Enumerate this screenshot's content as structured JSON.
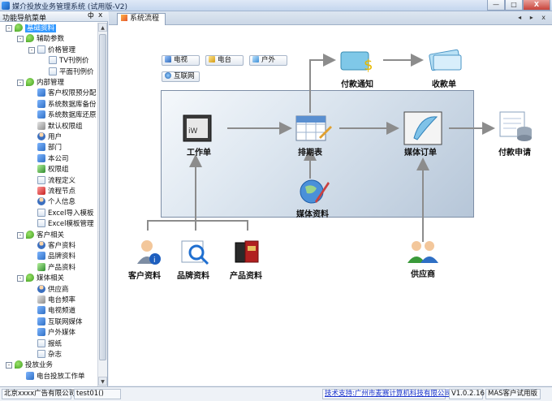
{
  "window": {
    "title": "媒介投放业务管理系统 (试用版-V2)",
    "min": "—",
    "max": "□",
    "close": "X"
  },
  "left_panel": {
    "header": "功能导航菜单",
    "pin": "ф",
    "close": "x",
    "tree": [
      {
        "label": "基础资料",
        "level": 0,
        "icon": "leaf",
        "exp": "-",
        "selected": true
      },
      {
        "label": "辅助参数",
        "level": 1,
        "icon": "leaf",
        "exp": "-"
      },
      {
        "label": "价格管理",
        "level": 2,
        "icon": "doc",
        "exp": "-"
      },
      {
        "label": "TV刊例价",
        "level": 3,
        "icon": "doc"
      },
      {
        "label": "平面刊例价",
        "level": 3,
        "icon": "doc"
      },
      {
        "label": "内部管理",
        "level": 1,
        "icon": "leaf",
        "exp": "-"
      },
      {
        "label": "客户权限预分配",
        "level": 2,
        "icon": "blue"
      },
      {
        "label": "系统数据库备份",
        "level": 2,
        "icon": "blue"
      },
      {
        "label": "系统数据库还原",
        "level": 2,
        "icon": "blue"
      },
      {
        "label": "默认权限组",
        "level": 2,
        "icon": "gray"
      },
      {
        "label": "用户",
        "level": 2,
        "icon": "person"
      },
      {
        "label": "部门",
        "level": 2,
        "icon": "blue"
      },
      {
        "label": "本公司",
        "level": 2,
        "icon": "blue"
      },
      {
        "label": "权限组",
        "level": 2,
        "icon": "green"
      },
      {
        "label": "流程定义",
        "level": 2,
        "icon": "doc"
      },
      {
        "label": "流程节点",
        "level": 2,
        "icon": "red"
      },
      {
        "label": "个人信息",
        "level": 2,
        "icon": "person"
      },
      {
        "label": "Excel导入模板",
        "level": 2,
        "icon": "doc"
      },
      {
        "label": "Excel模板管理",
        "level": 2,
        "icon": "doc"
      },
      {
        "label": "客户相关",
        "level": 1,
        "icon": "leaf",
        "exp": "-"
      },
      {
        "label": "客户资料",
        "level": 2,
        "icon": "person"
      },
      {
        "label": "品牌资料",
        "level": 2,
        "icon": "blue"
      },
      {
        "label": "产品资料",
        "level": 2,
        "icon": "green"
      },
      {
        "label": "媒体相关",
        "level": 1,
        "icon": "leaf",
        "exp": "-"
      },
      {
        "label": "供应商",
        "level": 2,
        "icon": "person"
      },
      {
        "label": "电台频率",
        "level": 2,
        "icon": "gray"
      },
      {
        "label": "电视频道",
        "level": 2,
        "icon": "blue"
      },
      {
        "label": "互联网媒体",
        "level": 2,
        "icon": "blue"
      },
      {
        "label": "户外媒体",
        "level": 2,
        "icon": "blue"
      },
      {
        "label": "报纸",
        "level": 2,
        "icon": "doc"
      },
      {
        "label": "杂志",
        "level": 2,
        "icon": "doc"
      },
      {
        "label": "投放业务",
        "level": 0,
        "icon": "leaf",
        "exp": "-"
      },
      {
        "label": "电台投放工作单",
        "level": 1,
        "icon": "blue"
      }
    ]
  },
  "tabs": [
    {
      "label": "系统流程"
    }
  ],
  "tab_controls": "◂ ▸ x",
  "flow": {
    "media_types": [
      "电视",
      "电台",
      "户外",
      "互联网"
    ],
    "nodes": {
      "work_order": "工作单",
      "schedule": "排期表",
      "media_order": "媒体订单",
      "payment_request": "付款申请",
      "payment_notice": "付款通知",
      "receipt": "收款单",
      "media_info": "媒体资料",
      "customer_info": "客户资料",
      "brand_info": "品牌资料",
      "product_info": "产品资料",
      "supplier": "供应商"
    }
  },
  "status_bar": {
    "company": "北京xxxx广告有限公司",
    "user": "test01()",
    "support": "技术支持:广州市麦赛计算机科技有限公司",
    "version": "V1.0.2.16",
    "edition": "MAS客户试用版"
  },
  "colors": {
    "selection": "#3399ff",
    "arrow": "#8c8c8c",
    "link": "#1a33cc"
  }
}
